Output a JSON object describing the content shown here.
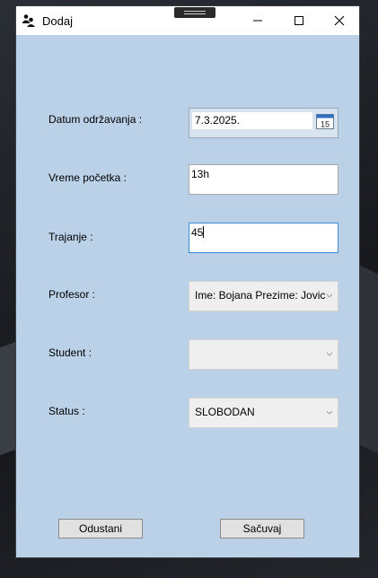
{
  "window": {
    "title": "Dodaj"
  },
  "form": {
    "date_label": "Datum održavanja :",
    "date_value": "7.3.2025.",
    "calendar_day": "15",
    "time_label": "Vreme početka :",
    "time_value": "13h",
    "duration_label": "Trajanje :",
    "duration_value": "45",
    "professor_label": "Profesor :",
    "professor_value": "Ime: Bojana Prezime: Jovic",
    "student_label": "Student :",
    "student_value": "",
    "status_label": "Status :",
    "status_value": "SLOBODAN"
  },
  "buttons": {
    "cancel": "Odustani",
    "save": "Sačuvaj"
  },
  "icons": {
    "app": "users-icon",
    "minimize": "minimize-icon",
    "maximize": "maximize-icon",
    "close": "close-icon",
    "calendar": "calendar-icon",
    "dropdown": "chevron-down-icon"
  },
  "colors": {
    "form_background": "#bad1e8",
    "titlebar": "#ffffff",
    "focus_border": "#3b8bd8",
    "calendar_accent": "#2f6fc1"
  }
}
